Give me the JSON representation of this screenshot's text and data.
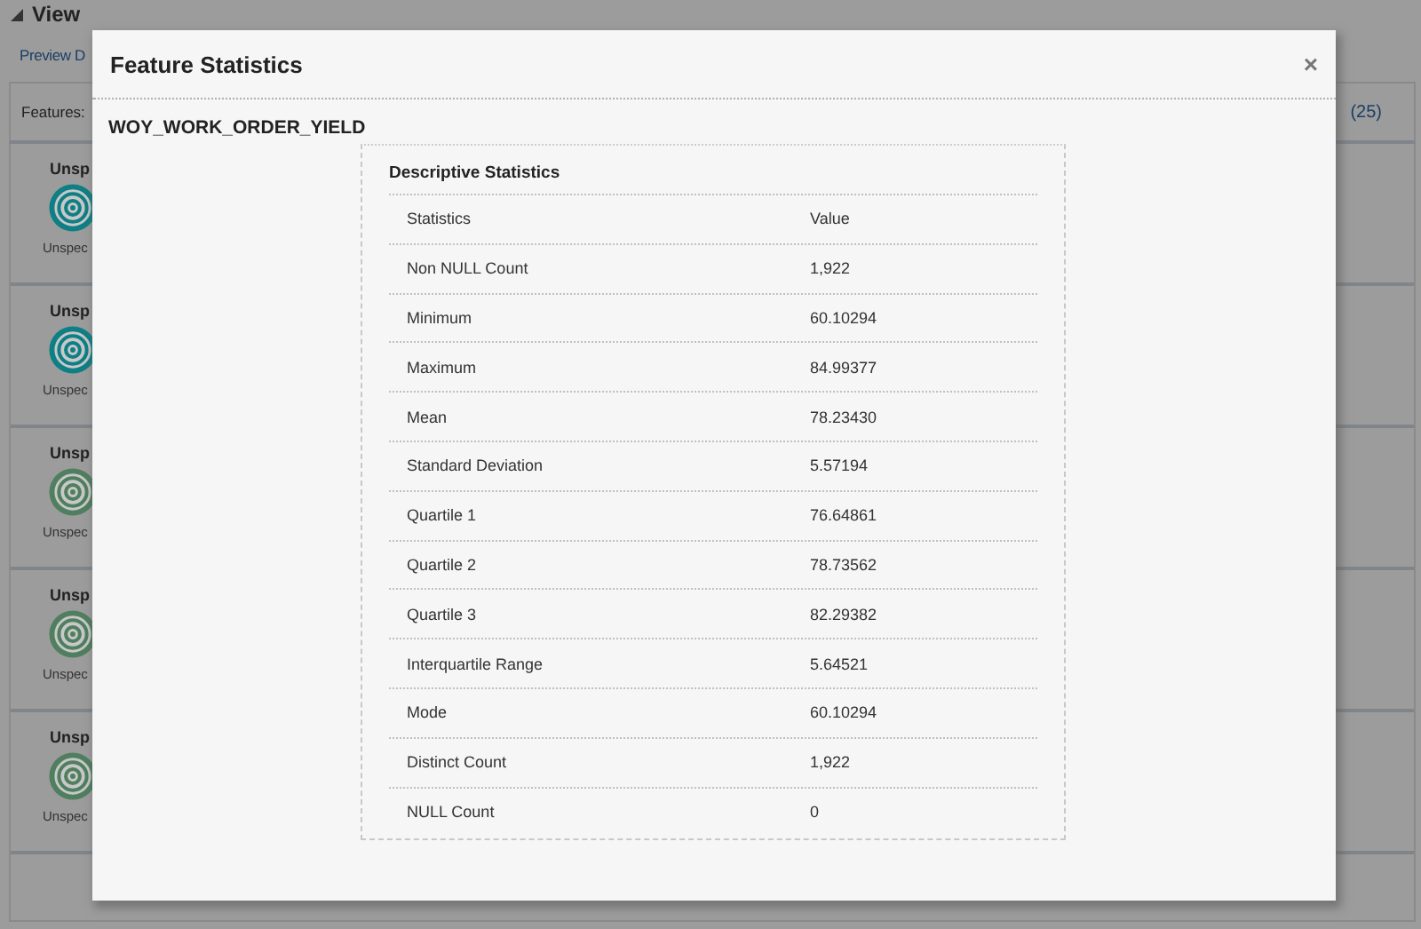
{
  "page": {
    "section_title": "View",
    "preview_link": "Preview D",
    "features_label": "Features:",
    "features_count": "(25)",
    "cards": [
      {
        "title": "Unsp",
        "caption": "Unspec",
        "color": "#0e7f84"
      },
      {
        "title": "Unsp",
        "caption": "Unspec",
        "color": "#0e7f84"
      },
      {
        "title": "Unsp",
        "caption": "Unspec",
        "color": "#4f7f5e"
      },
      {
        "title": "Unsp",
        "caption": "Unspec",
        "color": "#4f7f5e"
      },
      {
        "title": "Unsp",
        "caption": "Unspec",
        "color": "#4f7f5e"
      }
    ]
  },
  "dialog": {
    "title": "Feature Statistics",
    "close": "×",
    "feature_name": "WOY_WORK_ORDER_YIELD",
    "panel_title": "Descriptive Statistics",
    "columns": [
      "Statistics",
      "Value"
    ],
    "rows": [
      [
        "Non NULL Count",
        "1,922"
      ],
      [
        "Minimum",
        "60.10294"
      ],
      [
        "Maximum",
        "84.99377"
      ],
      [
        "Mean",
        "78.23430"
      ],
      [
        "Standard Deviation",
        "5.57194"
      ],
      [
        "Quartile 1",
        "76.64861"
      ],
      [
        "Quartile 2",
        "78.73562"
      ],
      [
        "Quartile 3",
        "82.29382"
      ],
      [
        "Interquartile Range",
        "5.64521"
      ],
      [
        "Mode",
        "60.10294"
      ],
      [
        "Distinct Count",
        "1,922"
      ],
      [
        "NULL Count",
        "0"
      ]
    ]
  }
}
